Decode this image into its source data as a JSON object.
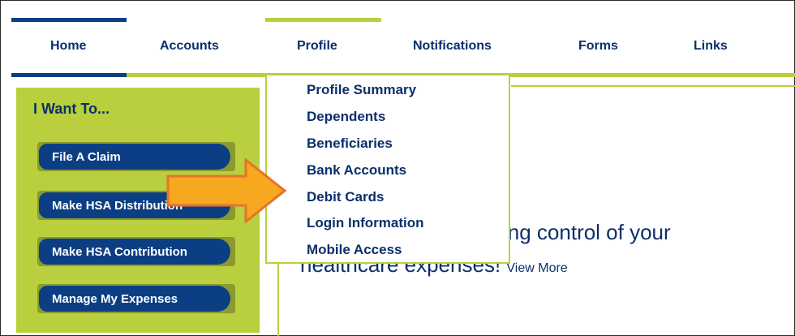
{
  "nav": {
    "items": [
      "Home",
      "Accounts",
      "Profile",
      "Notifications",
      "Forms",
      "Links"
    ],
    "active": "Profile"
  },
  "sidebar": {
    "title": "I Want To...",
    "buttons": [
      "File A Claim",
      "Make HSA Distribution",
      "Make HSA Contribution",
      "Manage My Expenses"
    ]
  },
  "dropdown": {
    "items": [
      "Profile Summary",
      "Dependents",
      "Beneficiaries",
      "Bank Accounts",
      "Debit Cards",
      "Login Information",
      "Mobile Access"
    ]
  },
  "content": {
    "partial_line1": "king control of your",
    "partial_line2": "healthcare expenses!",
    "view_more": "View More"
  },
  "colors": {
    "brand_green": "#b9cf3d",
    "brand_blue": "#0b2f6b",
    "button_blue": "#0c3e84",
    "arrow_orange": "#f6a81e"
  }
}
